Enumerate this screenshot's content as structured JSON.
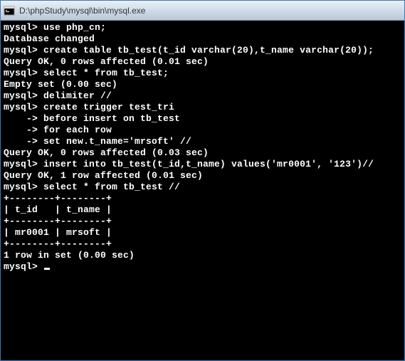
{
  "window": {
    "title": "D:\\phpStudy\\mysql\\bin\\mysql.exe"
  },
  "terminal": {
    "lines": [
      "",
      "mysql> use php_cn;",
      "Database changed",
      "mysql> create table tb_test(t_id varchar(20),t_name varchar(20));",
      "Query OK, 0 rows affected (0.01 sec)",
      "",
      "mysql> select * from tb_test;",
      "Empty set (0.00 sec)",
      "",
      "mysql> delimiter //",
      "mysql> create trigger test_tri",
      "    -> before insert on tb_test",
      "    -> for each row",
      "    -> set new.t_name='mrsoft' //",
      "Query OK, 0 rows affected (0.03 sec)",
      "",
      "mysql> insert into tb_test(t_id,t_name) values('mr0001', '123')//",
      "Query OK, 1 row affected (0.01 sec)",
      "",
      "mysql> select * from tb_test //",
      "+--------+--------+",
      "| t_id   | t_name |",
      "+--------+--------+",
      "| mr0001 | mrsoft |",
      "+--------+--------+",
      "1 row in set (0.00 sec)",
      "",
      "mysql> "
    ]
  }
}
